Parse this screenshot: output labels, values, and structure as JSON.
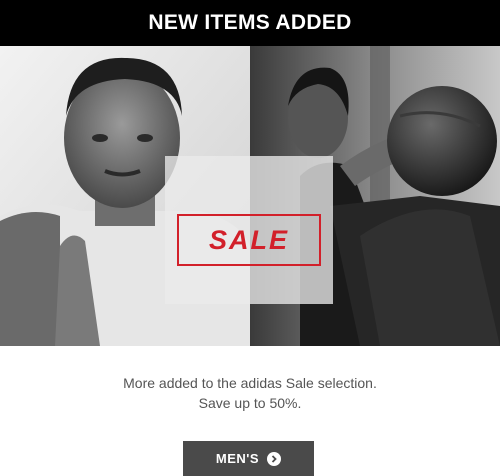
{
  "banner": {
    "title": "NEW ITEMS ADDED"
  },
  "hero": {
    "sale_label": "SALE",
    "accent_color": "#d2202a",
    "left_image": "man-athlete-portrait-bw",
    "right_image": "woman-medicine-ball-bw"
  },
  "copy": {
    "line1": "More added to the adidas Sale selection.",
    "line2": "Save up to 50%."
  },
  "cta": {
    "label": "MEN'S",
    "icon": "chevron-right-circle-icon"
  }
}
